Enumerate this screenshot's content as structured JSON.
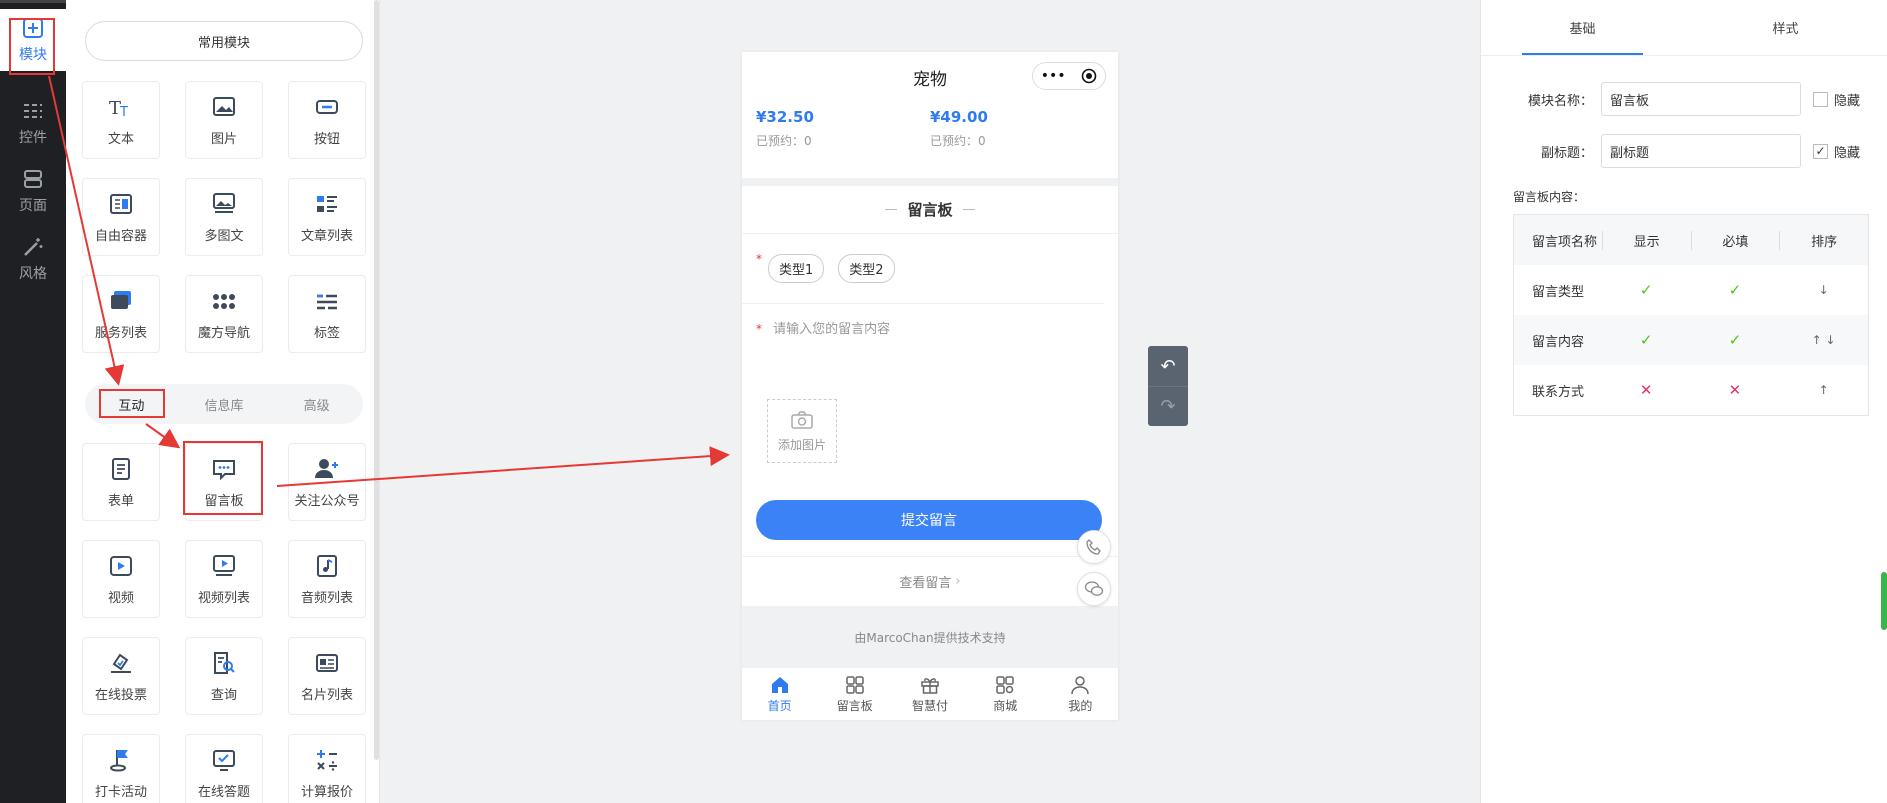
{
  "rail": {
    "items": [
      {
        "label": "模块",
        "icon": "plus-square-icon",
        "active": true
      },
      {
        "label": "控件",
        "icon": "sliders-icon"
      },
      {
        "label": "页面",
        "icon": "layers-icon"
      },
      {
        "label": "风格",
        "icon": "magic-wand-icon"
      }
    ]
  },
  "modules": {
    "common_label": "常用模块",
    "basic": [
      "文本",
      "图片",
      "按钮",
      "自由容器",
      "多图文",
      "文章列表",
      "服务列表",
      "魔方导航",
      "标签"
    ],
    "tabs": [
      "互动",
      "信息库",
      "高级"
    ],
    "interactive": [
      "表单",
      "留言板",
      "关注公众号",
      "视频",
      "视频列表",
      "音频列表",
      "在线投票",
      "查询",
      "名片列表",
      "打卡活动",
      "在线答题",
      "计算报价"
    ]
  },
  "phone": {
    "title": "宠物",
    "capsule_more": "•••",
    "prices": [
      {
        "price": "¥32.50",
        "sold": "已预约：0"
      },
      {
        "price": "¥49.00",
        "sold": "已预约：0"
      }
    ],
    "board_title": "留言板",
    "required_mark": "*",
    "types": [
      "类型1",
      "类型2"
    ],
    "content_placeholder": "请输入您的留言内容",
    "add_image": "添加图片",
    "submit": "提交留言",
    "view": "查看留言",
    "footer_note": "由MarcoChan提供技术支持",
    "tabbar": [
      "首页",
      "留言板",
      "智慧付",
      "商城",
      "我的"
    ]
  },
  "settings": {
    "tabs": [
      "基础",
      "样式"
    ],
    "name_label": "模块名称：",
    "name_value": "留言板",
    "subtitle_label": "副标题：",
    "subtitle_value": "副标题",
    "hide_label": "隐藏",
    "hide_checked_mark": "✓",
    "content_label": "留言板内容：",
    "table_headers": [
      "留言项名称",
      "显示",
      "必填",
      "排序"
    ],
    "rows": [
      {
        "name": "留言类型",
        "show": "✓",
        "required": "✓",
        "sort": "↓"
      },
      {
        "name": "留言内容",
        "show": "✓",
        "required": "✓",
        "sort": "↑  ↓"
      },
      {
        "name": "联系方式",
        "show": "✕",
        "required": "✕",
        "sort": "↑"
      }
    ]
  },
  "colors": {
    "accent": "#2f7bf0",
    "annotation": "#e53935",
    "rail": "#1f2023"
  }
}
